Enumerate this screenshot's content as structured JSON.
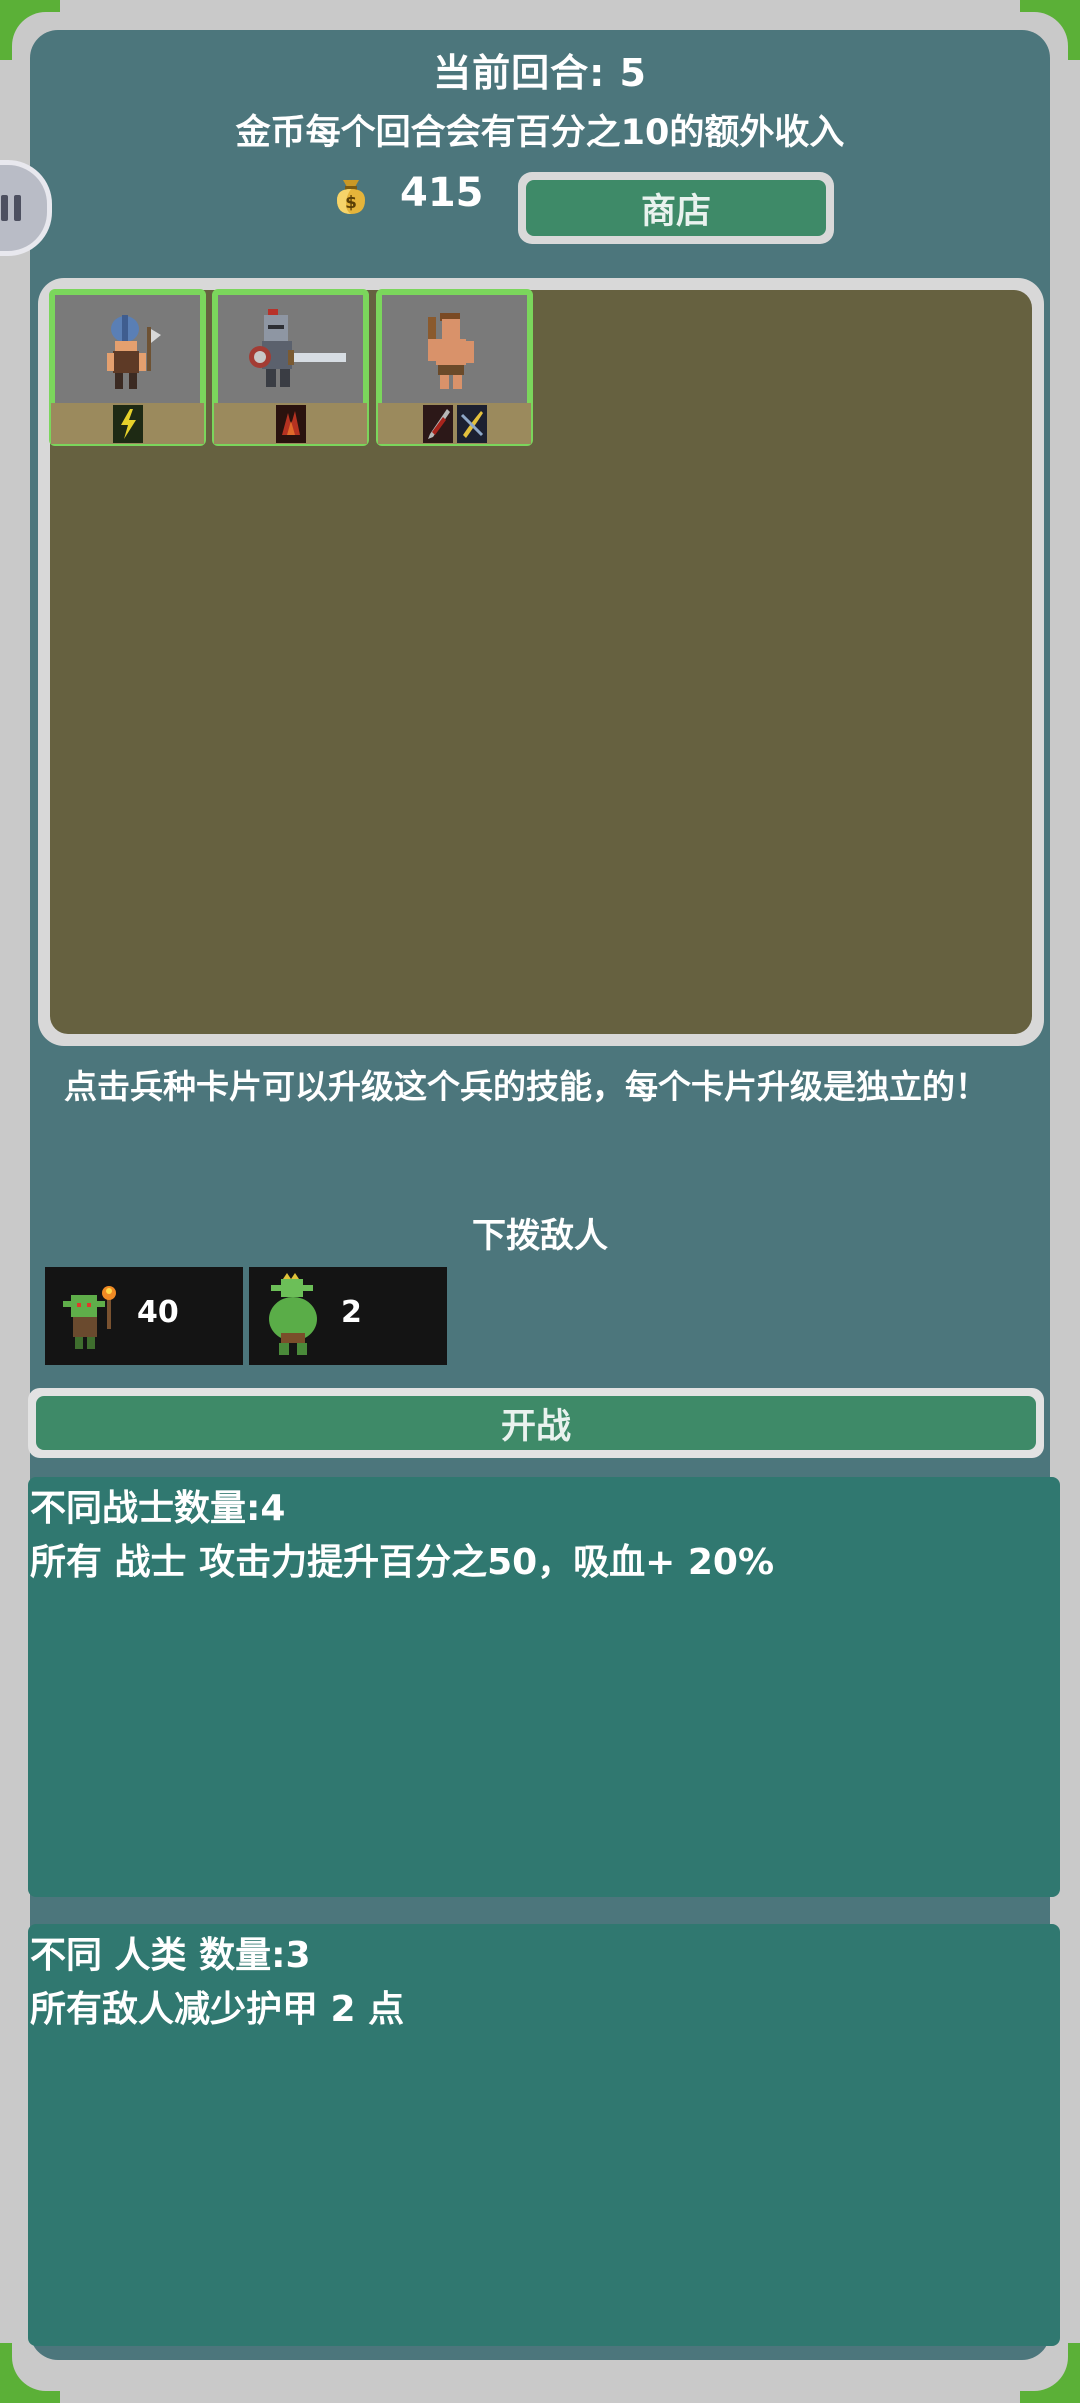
{
  "header": {
    "round_label": "当前回合: 5",
    "income_text": "金币每个回合会有百分之10的额外收入"
  },
  "gold": {
    "icon": "money-bag-icon",
    "amount": "415"
  },
  "shop_button": {
    "label": "商店"
  },
  "pause_button": {
    "icon": "pause-icon"
  },
  "units": [
    {
      "name": "blue-helmet-axe-warrior",
      "skills": [
        "lightning-skill-icon"
      ]
    },
    {
      "name": "armored-knight",
      "skills": [
        "red-rage-skill-icon"
      ]
    },
    {
      "name": "barbarian",
      "skills": [
        "blood-blade-skill-icon",
        "golden-slash-skill-icon"
      ]
    }
  ],
  "hint_text": "点击兵种卡片可以升级这个兵的技能，每个卡片升级是独立的！",
  "enemies": {
    "title": "下拨敌人",
    "list": [
      {
        "name": "goblin-torchbearer",
        "count": "40"
      },
      {
        "name": "green-ogre",
        "count": "2"
      }
    ]
  },
  "battle_button": {
    "label": "开战"
  },
  "bonuses": [
    {
      "title": "不同战士数量:4",
      "description": "所有 战士 攻击力提升百分之50，吸血+ 20%"
    },
    {
      "title": "不同 人类 数量:3",
      "description": "所有敌人减少护甲 2 点"
    }
  ],
  "colors": {
    "panel": "#4c767c",
    "board": "#666140",
    "button_green": "#3e8a68",
    "bonus_panel": "#307870",
    "card_border": "#7bd65c"
  }
}
